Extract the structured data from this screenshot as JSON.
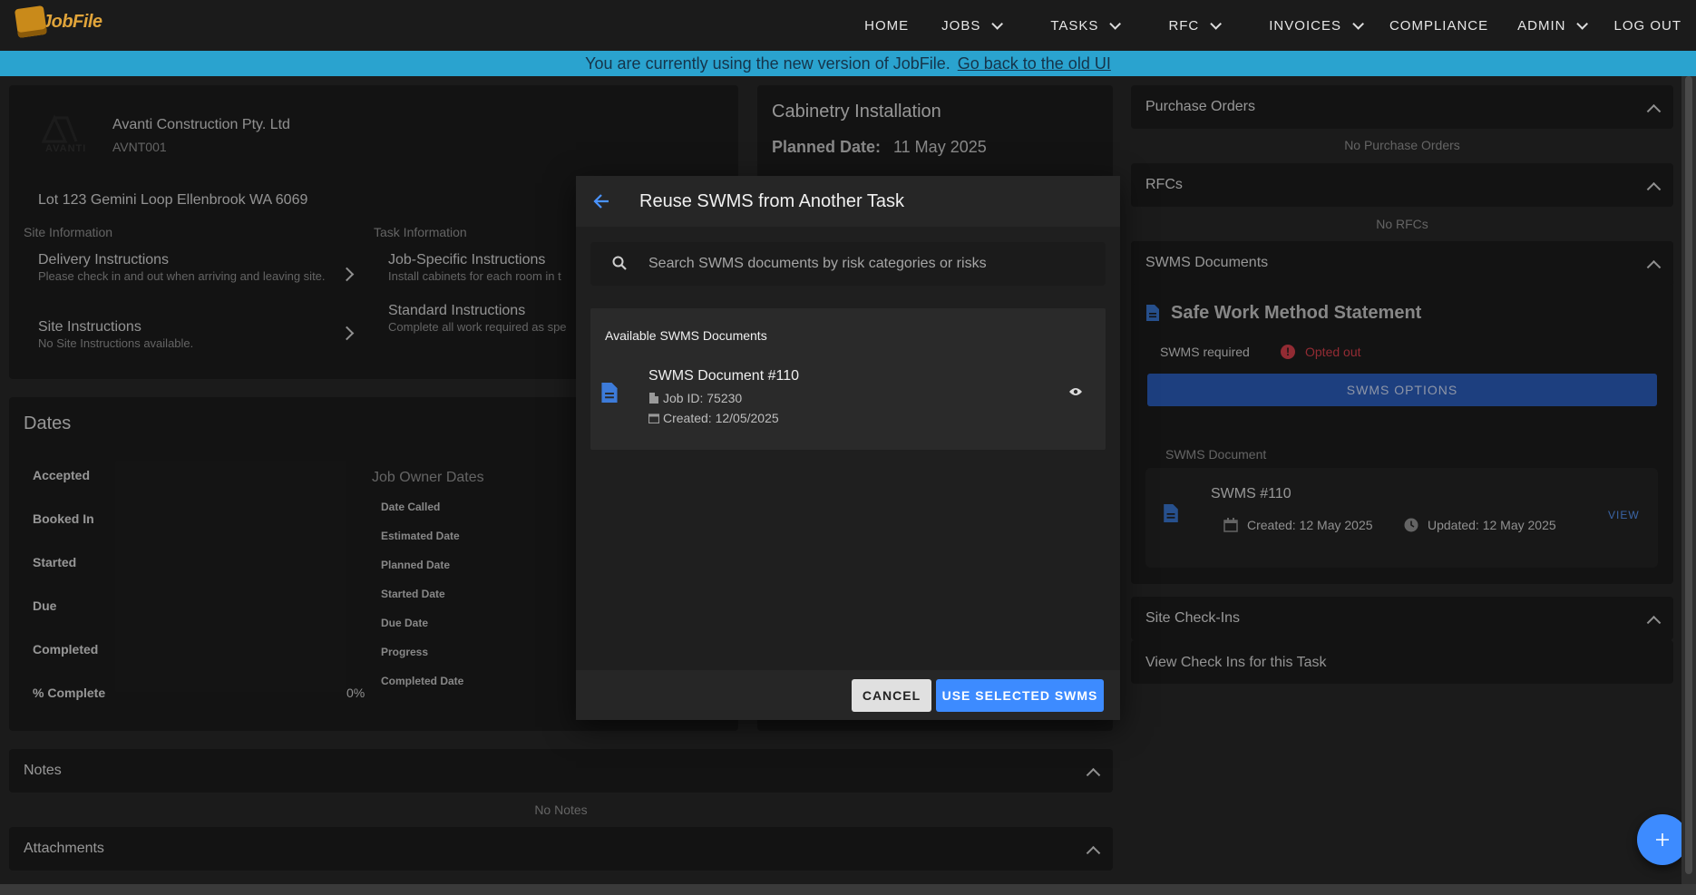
{
  "nav": {
    "logo_text": "JobFile",
    "items": [
      {
        "label": "HOME",
        "dropdown": false
      },
      {
        "label": "JOBS",
        "dropdown": true
      },
      {
        "label": "TASKS",
        "dropdown": true
      },
      {
        "label": "RFC",
        "dropdown": true
      },
      {
        "label": "INVOICES",
        "dropdown": true
      },
      {
        "label": "COMPLIANCE",
        "dropdown": false
      },
      {
        "label": "ADMIN",
        "dropdown": true
      },
      {
        "label": "LOG OUT",
        "dropdown": false
      }
    ]
  },
  "banner": {
    "text": "You are currently using the new version of JobFile.",
    "link": "Go back to the old UI"
  },
  "client": {
    "logo_text": "AVANTI",
    "name": "Avanti Construction Pty. Ltd",
    "code": "AVNT001",
    "address": "Lot 123 Gemini Loop Ellenbrook WA 6069"
  },
  "site_info": {
    "label": "Site Information",
    "delivery_title": "Delivery Instructions",
    "delivery_text": "Please check in and out when arriving and leaving site.",
    "site_title": "Site Instructions",
    "site_text": "No Site Instructions available."
  },
  "task_info": {
    "label": "Task Information",
    "job_specific_title": "Job-Specific Instructions",
    "job_specific_text": "Install cabinets for each room in t",
    "standard_title": "Standard Instructions",
    "standard_text": "Complete all work required as spe"
  },
  "task": {
    "title": "Cabinetry Installation",
    "planned_label": "Planned Date:",
    "planned_value": "11 May 2025"
  },
  "dates": {
    "title": "Dates",
    "rows": [
      "Accepted",
      "Booked In",
      "Started",
      "Due",
      "Completed",
      "% Complete"
    ],
    "percent_value": "0%",
    "owner_title": "Job Owner Dates",
    "owner_rows": [
      "Date Called",
      "Estimated Date",
      "Planned Date",
      "Started Date",
      "Due Date",
      "Progress",
      "Completed Date"
    ]
  },
  "notes": {
    "title": "Notes",
    "empty": "No Notes"
  },
  "attachments": {
    "title": "Attachments"
  },
  "right": {
    "purchase_orders": {
      "title": "Purchase Orders",
      "empty": "No Purchase Orders"
    },
    "rfcs": {
      "title": "RFCs",
      "empty": "No RFCs"
    },
    "swms": {
      "title": "SWMS Documents",
      "heading": "Safe Work Method Statement",
      "required_label": "SWMS required",
      "status": "Opted out",
      "options_button": "SWMS OPTIONS",
      "doc_section_label": "SWMS Document",
      "doc_title": "SWMS #110",
      "created": "Created: 12 May 2025",
      "updated": "Updated: 12 May 2025",
      "view": "VIEW"
    },
    "checkins": {
      "title": "Site Check-Ins",
      "link": "View Check Ins for this Task"
    }
  },
  "modal": {
    "title": "Reuse SWMS from Another Task",
    "search_placeholder": "Search SWMS documents by risk categories or risks",
    "available_label": "Available SWMS Documents",
    "doc": {
      "title": "SWMS Document #110",
      "job_id": "Job ID: 75230",
      "created": "Created: 12/05/2025"
    },
    "cancel": "CANCEL",
    "use": "USE SELECTED SWMS"
  },
  "colors": {
    "accent": "#3d8bff",
    "banner": "#2aa3cf",
    "opted_out": "#e0434f",
    "swms_button": "#2d61c4"
  }
}
